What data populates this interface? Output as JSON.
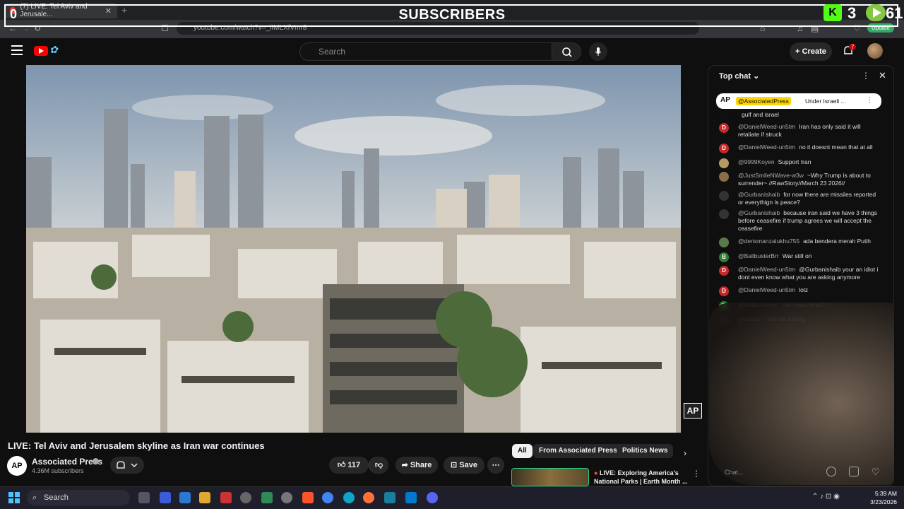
{
  "browser": {
    "tab_title": "(7) LIVE: Tel Aviv and Jerusale...",
    "url": "youtube.com/watch?v=_iIMLXfVmr8",
    "update_label": "Update"
  },
  "overlay": {
    "subscribers_count": "0",
    "subscribers_label": "SUBSCRIBERS",
    "kick_count": "3",
    "rumble_count": "61"
  },
  "header": {
    "search_placeholder": "Search",
    "create_label": "Create",
    "notification_count": "7"
  },
  "video": {
    "title": "LIVE: Tel Aviv and Jerusalem skyline as Iran war continues",
    "watermark": "AP",
    "channel_name": "Associated Press",
    "channel_initials": "AP",
    "subscribers": "4.36M subscribers",
    "likes": "117",
    "share_label": "Share",
    "save_label": "Save"
  },
  "filters": [
    "All",
    "From Associated Press",
    "Politics News"
  ],
  "recommendation": {
    "title": "LIVE: Exploring America's National Parks | Earth Month ..."
  },
  "chat": {
    "header": "Top chat",
    "pinned_handle": "@AssociatedPress",
    "pinned_text": "Under Israeli ...",
    "input_placeholder": "Chat...",
    "messages": [
      {
        "initial": "",
        "color": "#0f0f0f",
        "author": "",
        "text": "gulf and israel"
      },
      {
        "initial": "D",
        "color": "#c62828",
        "author": "@DanielWeed-un5tm",
        "text": "Iran has only said it will retaliate if struck"
      },
      {
        "initial": "D",
        "color": "#c62828",
        "author": "@DanielWeed-un5tm",
        "text": "no it doesnt mean that at all"
      },
      {
        "initial": "",
        "color": "#b59a62",
        "author": "@9999Koyen",
        "text": "Support Iran"
      },
      {
        "initial": "",
        "color": "#8a6e4a",
        "author": "@JustSmileNWave-w3w",
        "text": "~Why Trump is about to surrender~ //RawStory//March 23 2026//"
      },
      {
        "initial": "",
        "color": "#333333",
        "author": "@Gurbanishaib",
        "text": "for now there are missiles reported or everythign is peace?"
      },
      {
        "initial": "",
        "color": "#333333",
        "author": "@Gurbanishaib",
        "text": "because iran said we have 3 things before ceasefire if trump agrees we will accept the ceasefire"
      },
      {
        "initial": "",
        "color": "#5a7a4a",
        "author": "@derismanzalukhu755",
        "text": "ada bendera merah Putih"
      },
      {
        "initial": "B",
        "color": "#2e7d32",
        "author": "@BallbusterBrr",
        "text": "War still on"
      },
      {
        "initial": "D",
        "color": "#c62828",
        "author": "@DanielWeed-un5tm",
        "text": "@Gurbanishaib your an idiot i dont even know what you are asking anymore"
      },
      {
        "initial": "D",
        "color": "#c62828",
        "author": "@DanielWeed-un5tm",
        "text": "lolz"
      },
      {
        "initial": "B",
        "color": "#2e7d32",
        "author": "@BallbusterBrr",
        "text": "Iran have what?"
      },
      {
        "initial": "",
        "color": "#333333",
        "author": "@Gurba",
        "text": "I am not asking"
      }
    ]
  },
  "taskbar": {
    "search_label": "Search",
    "time": "5:39 AM",
    "date": "3/23/2026"
  }
}
